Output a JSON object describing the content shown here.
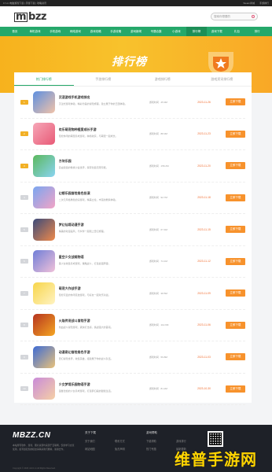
{
  "topbar": {
    "left": "17.cn 电脑游戏下载 | 手游下载 | 攻略资讯",
    "right": [
      "Steam商城",
      "手游排行"
    ]
  },
  "header": {
    "logo": "mbzz",
    "search_placeholder": "搜索你想要的"
  },
  "nav": [
    "首页",
    "单机游戏",
    "手机游戏",
    "网络游戏",
    "游戏攻略",
    "手游攻略",
    "游戏新闻",
    "专题合集",
    "小游戏",
    "排行榜",
    "游戏下载",
    "礼包",
    "排行"
  ],
  "banner": {
    "title": "排行榜"
  },
  "tabs": [
    "热门排行榜",
    "手游排行榜",
    "游戏排行榜",
    "游戏资讯排行榜"
  ],
  "rows": [
    {
      "rank": "1",
      "name": "沉浸游戏手机游戏排名",
      "desc": "沉浸式游戏体验，精彩纷呈的冒险旅程，建立属于你的王国体验。",
      "meta": "游戏时间  · 45.9M",
      "date": "2023-11-26",
      "btn": "立即下载",
      "colors": [
        "#5d8fe0",
        "#f2c3a8"
      ]
    },
    {
      "rank": "2",
      "name": "欢乐萌宠物种植爱成长手游",
      "desc": "轻松休闲的萌宠养成游戏，种植收获，与萌宠一起成长。",
      "meta": "游戏时间  · 88.3M",
      "date": "2023-11-23",
      "btn": "立即下载",
      "colors": [
        "#f6a7b8",
        "#e85a76"
      ]
    },
    {
      "rank": "3",
      "name": "方块乐园",
      "desc": "自由建造的像素沙盒世界，探索创造无限可能。",
      "meta": "游戏时间  · 156.2M",
      "date": "2023-11-20",
      "btn": "立即下载",
      "colors": [
        "#5bb85d",
        "#8ad4f2"
      ]
    },
    {
      "rank": "4",
      "name": "幻想乐园冒险角色扮演",
      "desc": "二次元风格角色扮演游戏，精美立绘，丰富的剧情体验。",
      "meta": "游戏时间  · 92.7M",
      "date": "2023-11-18",
      "btn": "立即下载",
      "colors": [
        "#7aa6f0",
        "#f3a3c6"
      ]
    },
    {
      "rank": "5",
      "name": "梦幻仙境动漫手游",
      "desc": "精美的动漫画风，与伙伴一起踏上奇幻旅程。",
      "meta": "游戏时间  · 67.4M",
      "date": "2023-11-15",
      "btn": "立即下载",
      "colors": [
        "#3b4a7a",
        "#f08a4a"
      ]
    },
    {
      "rank": "6",
      "name": "星空少女战姬物语",
      "desc": "美少女收集养成游戏，策略战斗，打造最强阵容。",
      "meta": "游戏时间  · 74.1M",
      "date": "2023-11-12",
      "btn": "立即下载",
      "colors": [
        "#6f7ed8",
        "#f1c1d9"
      ]
    },
    {
      "rank": "7",
      "name": "萌宠大作战手游",
      "desc": "轻松可爱的休闲竞技游戏，与好友一起欢乐对战。",
      "meta": "游戏时间  · 38.5M",
      "date": "2023-11-09",
      "btn": "立即下载",
      "colors": [
        "#f7d54a",
        "#fff3c2"
      ]
    },
    {
      "rank": "8",
      "name": "火焰传说战斗冒险手游",
      "desc": "热血战斗冒险游戏，爽快打击感，挑战强大的首领。",
      "meta": "游戏时间  · 112.6M",
      "date": "2023-11-06",
      "btn": "立即下载",
      "colors": [
        "#b5341f",
        "#f5a623"
      ]
    },
    {
      "rank": "9",
      "name": "动漫奇幻冒险角色手游",
      "desc": "奇幻冒险世界，收集英雄，组建属于你的战斗队伍。",
      "meta": "游戏时间  · 59.8M",
      "date": "2023-11-03",
      "btn": "立即下载",
      "colors": [
        "#3d6bd4",
        "#e9c27a"
      ]
    },
    {
      "rank": "10",
      "name": "少女梦境乐园物语手游",
      "desc": "温馨治愈的少女养成游戏，打造梦幻般的甜蜜生活。",
      "meta": "游戏时间  · 81.2M",
      "date": "2023-10-30",
      "btn": "立即下载",
      "colors": [
        "#c98bd9",
        "#f6d0a5"
      ]
    }
  ],
  "footer": {
    "logo": "MBZZ.CN",
    "text": "本站所有软件、游戏、图片资源均来源于互联网，仅供学习交流使用，如有侵犯您的权益请联系我们删除，谢谢合作。",
    "col1_title": "关于下载",
    "col1": [
      "关于我们",
      "联系方式",
      "网站地图",
      "免责声明"
    ],
    "col2_title": "游戏帮助",
    "col2": [
      "下载帮助",
      "游戏排行",
      "热门专题",
      "最新更新"
    ],
    "copyright": "Copyright © 2023 mbzz.cn All Rights Reserved."
  },
  "watermark": "维普手游网"
}
